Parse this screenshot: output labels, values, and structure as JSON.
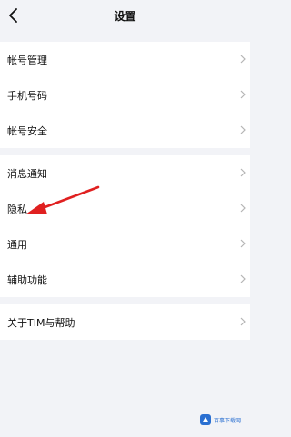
{
  "header": {
    "title": "设置"
  },
  "groups": [
    {
      "items": [
        {
          "label": "帐号管理"
        },
        {
          "label": "手机号码"
        },
        {
          "label": "帐号安全"
        }
      ]
    },
    {
      "items": [
        {
          "label": "消息通知"
        },
        {
          "label": "隐私"
        },
        {
          "label": "通用"
        },
        {
          "label": "辅助功能"
        }
      ]
    },
    {
      "items": [
        {
          "label": "关于TIM与帮助"
        }
      ]
    }
  ],
  "watermark": {
    "text": "百事下载网"
  },
  "colors": {
    "background": "#f2f3f7",
    "row": "#ffffff",
    "chevron": "#b5b5b5",
    "annotation_arrow": "#e02020"
  }
}
